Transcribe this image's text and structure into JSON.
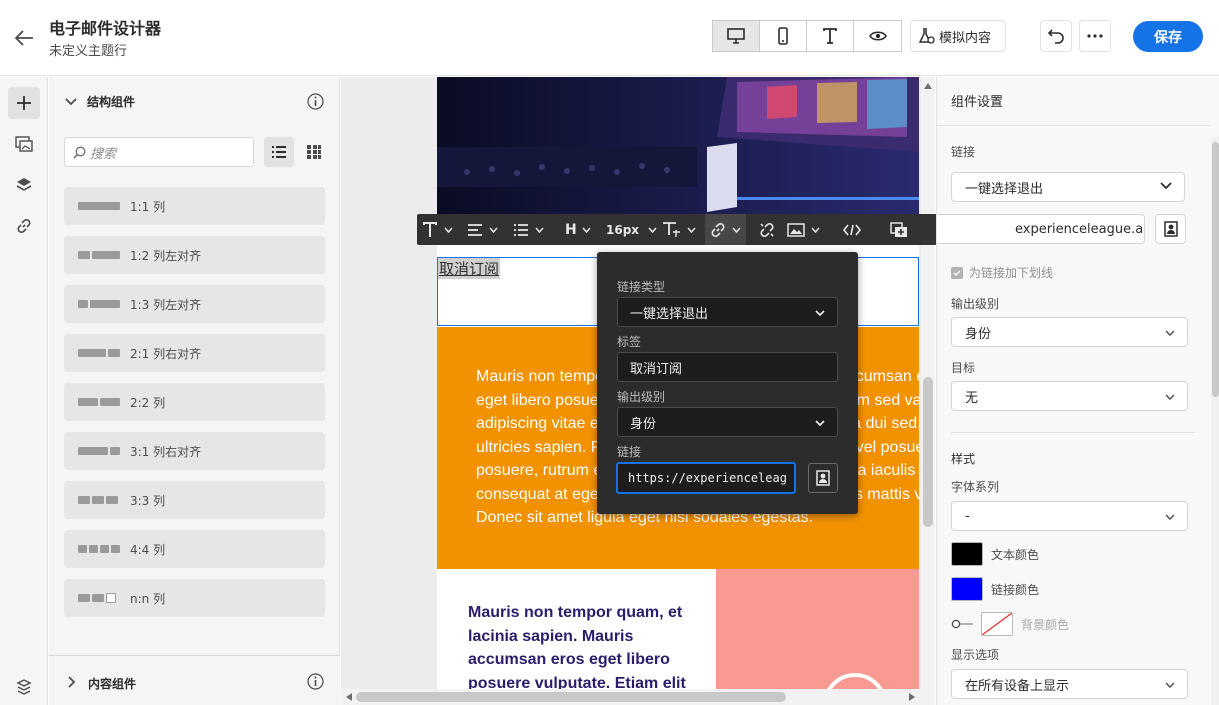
{
  "header": {
    "title": "电子邮件设计器",
    "subtitle": "未定义主题行",
    "simulate_label": "模拟内容",
    "save_label": "保存"
  },
  "left_panel": {
    "section_title": "结构组件",
    "search_placeholder": "搜索",
    "components": [
      "1:1 列",
      "1:2 列左对齐",
      "1:3 列左对齐",
      "2:1 列右对齐",
      "2:2 列",
      "3:1 列右对齐",
      "3:3 列",
      "4:4 列",
      "n:n 列"
    ],
    "content_section_title": "内容组件"
  },
  "canvas": {
    "unsubscribe_text": "取消订阅",
    "orange_lines": [
      "Mauris non tempor quam, et lacinia sapien. Mauris accumsan eros",
      "eget libero posuere vulputate. Etiam elit elit, elementum sed varius",
      "adipiscing vitae est. Sed nec felis pellentesque, lacinia dui sed,",
      "ultricies sapien. Pellentesque orci lectus, consectetur vel posuere",
      "posuere, rutrum eu ipsum. Aliquam eget odio sed ligula iaculis",
      "consequat at eget orci. Mauris molestie sit amet metus mattis varius.",
      "Donec sit amet ligula eget nisi sodales egestas."
    ],
    "white_col_text": "Mauris non tempor quam, et lacinia sapien. Mauris accumsan eros eget libero posuere vulputate. Etiam elit"
  },
  "toolbar": {
    "font_size": "16px"
  },
  "popover": {
    "link_type_label": "链接类型",
    "link_type_value": "一键选择退出",
    "tag_label": "标签",
    "tag_value": "取消订阅",
    "output_label": "输出级别",
    "output_value": "身份",
    "link_label": "链接",
    "link_value": "https://experienceleag"
  },
  "right_panel": {
    "title": "组件设置",
    "link_label": "链接",
    "link_type_value": "一键选择退出",
    "link_url_value": "experienceleague.adobe.c",
    "underline_label": "为链接加下划线",
    "output_label": "输出级别",
    "output_value": "身份",
    "target_label": "目标",
    "target_value": "无",
    "style_label": "样式",
    "font_family_label": "字体系列",
    "font_family_value": "-",
    "text_color_label": "文本颜色",
    "link_color_label": "链接颜色",
    "bg_color_label": "背景颜色",
    "display_label": "显示选项",
    "display_value": "在所有设备上显示"
  },
  "colors": {
    "accent": "#1473e6",
    "text_color": "#000000",
    "link_color": "#0000ff",
    "orange_block": "#f39200",
    "pink_block": "#f89a91"
  }
}
